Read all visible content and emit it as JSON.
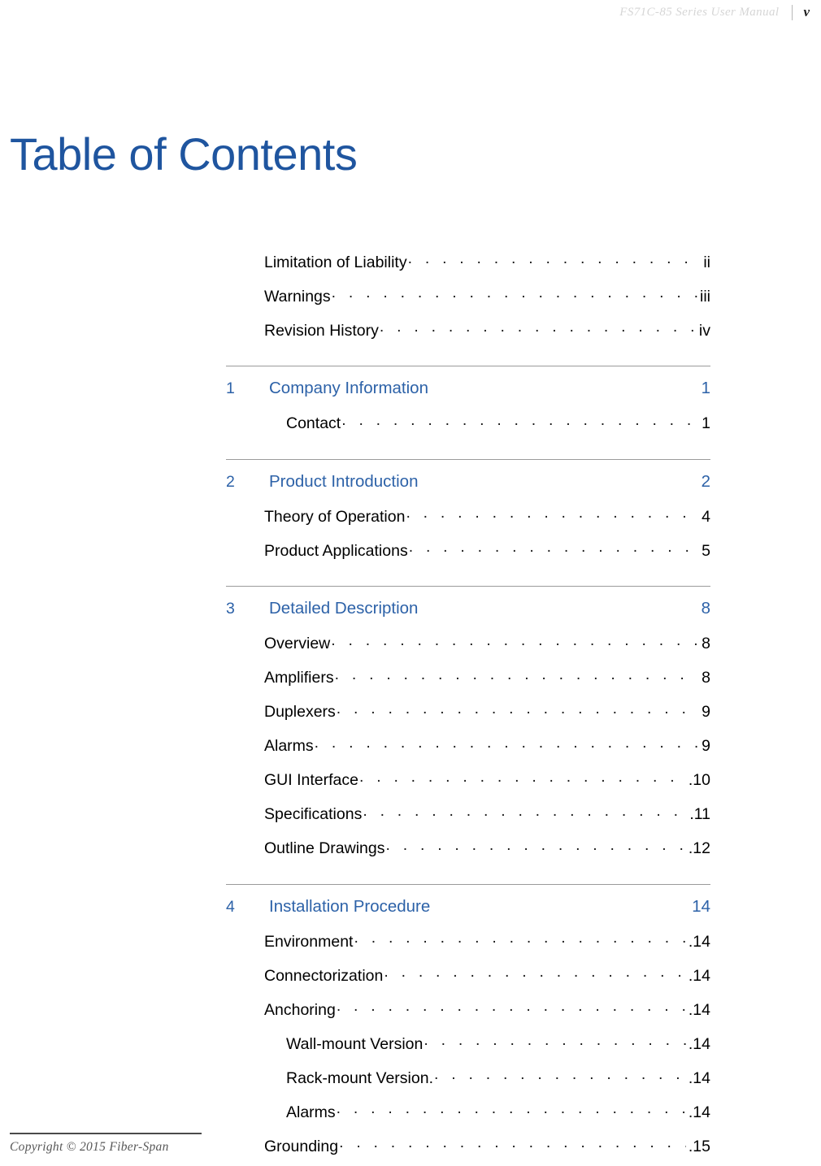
{
  "header": {
    "title": "FS71C-85 Series User Manual",
    "divider": "|",
    "page_number": "v"
  },
  "page_title": "Table of Contents",
  "colors": {
    "heading_blue": "#2d62a8",
    "title_blue": "#1f559f",
    "rule_gray": "#9b9b9b",
    "header_gray": "#d6d6d6",
    "footer_gray": "#585858"
  },
  "toc": {
    "front_matter": [
      {
        "label": "Limitation of Liability",
        "page": "ii"
      },
      {
        "label": "Warnings",
        "page": "iii"
      },
      {
        "label": "Revision History",
        "page": "iv"
      }
    ],
    "chapters": [
      {
        "number": "1",
        "title": "Company Information",
        "page": "1",
        "entries": [
          {
            "label": "Contact",
            "page": "1",
            "level": 2
          }
        ]
      },
      {
        "number": "2",
        "title": "Product Introduction",
        "page": "2",
        "entries": [
          {
            "label": "Theory of Operation",
            "page": "4",
            "level": 1
          },
          {
            "label": "Product Applications",
            "page": "5",
            "level": 1
          }
        ]
      },
      {
        "number": "3",
        "title": "Detailed Description",
        "page": "8",
        "entries": [
          {
            "label": "Overview",
            "page": "8",
            "level": 1
          },
          {
            "label": "Amplifiers",
            "page": "8",
            "level": 1
          },
          {
            "label": "Duplexers",
            "page": "9",
            "level": 1
          },
          {
            "label": "Alarms",
            "page": "9",
            "level": 1
          },
          {
            "label": "GUI Interface",
            "page": ".10",
            "level": 1
          },
          {
            "label": "Specifications",
            "page": ".11",
            "level": 1
          },
          {
            "label": "Outline Drawings",
            "page": ".12",
            "level": 1
          }
        ]
      },
      {
        "number": "4",
        "title": "Installation Procedure",
        "page": "14",
        "entries": [
          {
            "label": "Environment",
            "page": ".14",
            "level": 1
          },
          {
            "label": "Connectorization",
            "page": ".14",
            "level": 1
          },
          {
            "label": "Anchoring",
            "page": ".14",
            "level": 1
          },
          {
            "label": "Wall-mount Version",
            "page": ".14",
            "level": 2
          },
          {
            "label": "Rack-mount Version.",
            "page": ".14",
            "level": 2
          },
          {
            "label": "Alarms",
            "page": ".14",
            "level": 2
          },
          {
            "label": "Grounding",
            "page": ".15",
            "level": 1
          }
        ]
      }
    ]
  },
  "footer": {
    "copyright": "Copyright © 2015 Fiber-Span"
  }
}
